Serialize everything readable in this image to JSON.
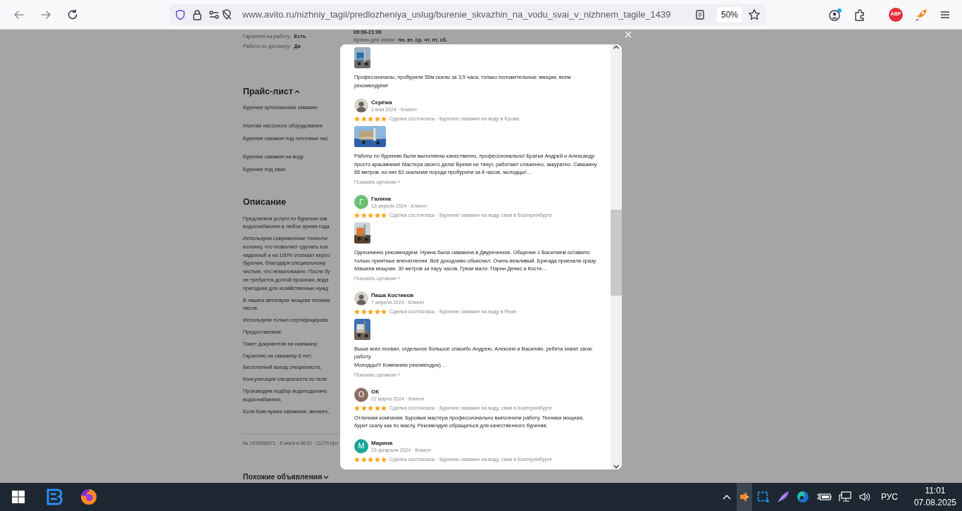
{
  "browser": {
    "url": "www.avito.ru/nizhniy_tagil/predlozheniya_uslug/burenie_skvazhin_na_vodu_svai_v_nizhnem_tagile_1439",
    "zoom": "50%",
    "adblock_badge": "ABP"
  },
  "page": {
    "details": [
      {
        "label": "Гарантия на работу:",
        "value": "Есть"
      },
      {
        "label": "Работа по договору:",
        "value": "Да"
      }
    ],
    "hours": "09:00-21:00",
    "contact": {
      "label": "Время для связи:",
      "value": "пн. вт. ср. чт. пт. сб."
    },
    "price_list": {
      "title": "Прайс-лист",
      "expanded": true,
      "items": [
        "Бурение артезианских скважин",
        "Монтаж насосного оборудования",
        "Бурение скважин под тепловые нас",
        "Бурение скважин на воду",
        "Бурение под сваи"
      ]
    },
    "description": {
      "title": "Описание",
      "paragraphs": [
        "Предлагаем услуги по бурению скв\nводоснабжения в любое время года",
        "Используем современные технолог\nколонну, что позволяет сделать кон\nнадежной и на 100% отсекает верхо\nбурения, благодаря специальному\nчистым, что немаловажно. После бу\nне требуется долгой прокачки, вода\nпригодная для хозяйственных нужд",
        "В нашем автопарке мощная техника\nчасов.",
        "Используем только сертифицирова",
        "Предоставляем:",
        "Пакет документов на скважину;",
        "Гарантию на скважину-5 лет;",
        "Бесплатный выезд специалиста;",
        "Консультация специалиста по теле",
        "Производим подбор водоподьемно\nводоснабжения.",
        "Если Вам нужна скважина- звоните,"
      ]
    },
    "listing_info": "№ 1439536471 · 8 июля в 06:51 · 11279 про",
    "similar": {
      "title": "Похожие объявления",
      "expanded": false
    }
  },
  "modal": {
    "reviews": [
      {
        "kind": "partial",
        "has_photo": true,
        "text": "Профессионалы, пробурили 55м скалы за 3,5 часа, только положительные эмоции, всем рекомендуем!"
      },
      {
        "kind": "full",
        "name": "Серёжа",
        "meta": "1 мая 2024 · Клиент",
        "stars": 5,
        "deal": "Сделка состоялась · Бурение скважин на воду в Кушве",
        "has_photo": true,
        "text": "Работы по бурению были выполнены качественно, профессионально! Братья Андрей и Александр просто красавчики! Мастера своего дела! Время не тянут, работают слаженно, аккуратно. Скважину 65 метров, из них 63 скальная порода пробурили за 8 часов, молодцы!…",
        "more": "Показать целиком"
      },
      {
        "kind": "full",
        "avatar": {
          "kind": "letter",
          "initial": "Г",
          "color": "#6cbf73"
        },
        "name": "Галина",
        "meta": "13 апреля 2024 · Клиент",
        "stars": 5,
        "deal": "Сделка состоялась · Бурение скважин на воду, сваи в Екатеринбурге",
        "has_photo": true,
        "text": "Однозначно рекомендуем. Нужна была скважина в Двуреченске. Общение с Василием оставило только приятные впечатления. Всё доходчиво обьяснил. Очень вежливый. Бригада приехала сразу. Машина мощная. 30 метров за пару часов. Грязи мало. Парни Денис и Костя…",
        "more": "Показать целиком"
      },
      {
        "kind": "full",
        "name": "Паша Костиков",
        "meta": "7 апреля 2024 · Клиент",
        "stars": 5,
        "deal": "Сделка состоялась · Бурение скважин на воду в Реже",
        "has_photo": true,
        "text": "Выше всех похвал, отдельное большое спасибо Андрею, Алексею и Василию, ребята знают свою работу.\nМолодцы!!! Компанию рекомендую) ..",
        "more": "Показать целиком"
      },
      {
        "kind": "full",
        "avatar": {
          "kind": "letter",
          "initial": "О",
          "color": "#8b6f62"
        },
        "name": "ОК",
        "meta": "22 марта 2024 · Клиент",
        "stars": 5,
        "deal": "Сделка состоялась · Бурение скважин на воду, сваи в Екатеринбурге",
        "has_photo": false,
        "text": "Отличная компания. Буровые мастера профессионально выполнили работу. Техника мощная, бурит скалу как по маслу. Рекомендую обращаться для качественного бурения."
      },
      {
        "kind": "full",
        "avatar": {
          "kind": "letter",
          "initial": "М",
          "color": "#1aa596"
        },
        "name": "Марина",
        "meta": "25 февраля 2024 · Клиент",
        "stars": 5,
        "deal": "Сделка состоялась · Бурение скважин на воду, сваи в Екатеринбурге",
        "has_photo": false
      }
    ]
  },
  "taskbar": {
    "language": "РУС",
    "time": "11:01",
    "date": "07.08.2025"
  }
}
